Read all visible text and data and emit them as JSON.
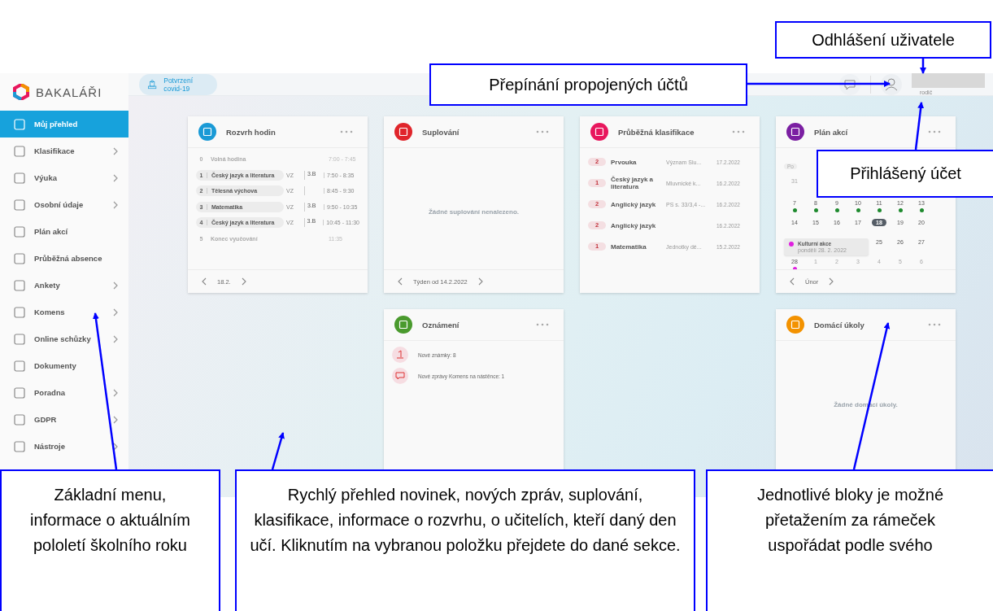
{
  "sidebar": {
    "brand": "BAKALÁŘI",
    "items": [
      {
        "label": "Můj přehled",
        "selected": true,
        "submenu": false
      },
      {
        "label": "Klasifikace",
        "selected": false,
        "submenu": true
      },
      {
        "label": "Výuka",
        "selected": false,
        "submenu": true
      },
      {
        "label": "Osobní údaje",
        "selected": false,
        "submenu": true
      },
      {
        "label": "Plán akcí",
        "selected": false,
        "submenu": false
      },
      {
        "label": "Průběžná absence",
        "selected": false,
        "submenu": false
      },
      {
        "label": "Ankety",
        "selected": false,
        "submenu": true
      },
      {
        "label": "Komens",
        "selected": false,
        "submenu": true
      },
      {
        "label": "Online schůzky",
        "selected": false,
        "submenu": true
      },
      {
        "label": "Dokumenty",
        "selected": false,
        "submenu": false
      },
      {
        "label": "Poradna",
        "selected": false,
        "submenu": true
      },
      {
        "label": "GDPR",
        "selected": false,
        "submenu": true
      },
      {
        "label": "Nástroje",
        "selected": false,
        "submenu": true
      }
    ]
  },
  "topbar": {
    "covid_button": "Potvrzení covid-19",
    "user_role": "rodič"
  },
  "cards": [
    {
      "kind": "schedule",
      "title": "Rozvrh hodin",
      "color": "#1a9ad6",
      "footer": "18.2.",
      "rows": [
        {
          "kind": "free",
          "num": "0",
          "subject": "Volná hodina",
          "time": "7:00 - 7:45"
        },
        {
          "kind": "lesson",
          "num": "1",
          "subject": "Český jazyk a literatura",
          "teacher": "VZ",
          "room": "3.B",
          "time": "7:50 - 8:35"
        },
        {
          "kind": "lesson",
          "num": "2",
          "subject": "Tělesná výchova",
          "teacher": "VZ",
          "time": "8:45 - 9:30"
        },
        {
          "kind": "lesson",
          "num": "3",
          "subject": "Matematika",
          "teacher": "VZ",
          "room": "3.B",
          "time": "9:50 - 10:35"
        },
        {
          "kind": "lesson",
          "num": "4",
          "subject": "Český jazyk a literatura",
          "teacher": "VZ",
          "room": "3.B",
          "time": "10:45 - 11:30"
        },
        {
          "kind": "free",
          "num": "5",
          "subject": "Konec vyučování",
          "time": "11:35"
        }
      ]
    },
    {
      "kind": "empty",
      "title": "Suplování",
      "color": "#e0252b",
      "footer": "Týden od 14.2.2022",
      "message": "Žádné suplování nenalezeno."
    },
    {
      "kind": "grades",
      "title": "Průběžná klasifikace",
      "color": "#e8175d",
      "rows": [
        {
          "grade": "2",
          "subject": "Prvouka",
          "note": "Význam Slu...",
          "date": "17.2.2022"
        },
        {
          "grade": "1",
          "subject": "Český jazyk a literatura",
          "note": "Mluvnické k...",
          "date": "16.2.2022"
        },
        {
          "grade": "2",
          "subject": "Anglický jazyk",
          "note": "PS s. 33/3,4 -...",
          "date": "16.2.2022"
        },
        {
          "grade": "2",
          "subject": "Anglický jazyk",
          "date": "16.2.2022"
        },
        {
          "grade": "1",
          "subject": "Matematika",
          "note": "Jednotky dé...",
          "date": "15.2.2022"
        }
      ]
    },
    {
      "kind": "calendar",
      "title": "Plán akcí",
      "color": "#7b1fa2",
      "footer": "Únor",
      "weekday": "Po",
      "weeks": [
        {
          "kind": "week",
          "days": [
            {
              "text": "31",
              "muted": true,
              "selected": false
            }
          ]
        },
        {
          "kind": "week",
          "days": [
            {
              "text": "7",
              "muted": false,
              "selected": false,
              "color": "#1e8a2e"
            },
            {
              "text": "8",
              "muted": false,
              "selected": false,
              "color": "#1e8a2e"
            },
            {
              "text": "9",
              "muted": false,
              "selected": false,
              "color": "#1e8a2e"
            },
            {
              "text": "10",
              "muted": false,
              "selected": false,
              "color": "#1e8a2e"
            },
            {
              "text": "11",
              "muted": false,
              "selected": false,
              "color": "#1e8a2e"
            },
            {
              "text": "12",
              "muted": false,
              "selected": false,
              "color": "#1e8a2e"
            },
            {
              "text": "13",
              "muted": false,
              "selected": false,
              "color": "#1e8a2e"
            }
          ]
        },
        {
          "kind": "week",
          "days": [
            {
              "text": "14",
              "muted": false,
              "selected": false
            },
            {
              "text": "15",
              "muted": false,
              "selected": false
            },
            {
              "text": "16",
              "muted": false,
              "selected": false
            },
            {
              "text": "17",
              "muted": false,
              "selected": false
            },
            {
              "text": "18",
              "muted": false,
              "selected": true
            },
            {
              "text": "19",
              "muted": false,
              "selected": false
            },
            {
              "text": "20",
              "muted": false,
              "selected": false
            }
          ]
        },
        {
          "kind": "tooltip",
          "tooltip": {
            "title": "Kulturní akce",
            "date": "pondělí 28. 2. 2022",
            "color": "#e020e0"
          },
          "days": [
            {
              "text": "25",
              "muted": false,
              "selected": false
            },
            {
              "text": "26",
              "muted": false,
              "selected": false
            },
            {
              "text": "27",
              "muted": false,
              "selected": false
            }
          ]
        },
        {
          "kind": "week",
          "days": [
            {
              "text": "28",
              "muted": false,
              "selected": false,
              "color": "#e020e0"
            },
            {
              "text": "1",
              "muted": true,
              "selected": false
            },
            {
              "text": "2",
              "muted": true,
              "selected": false
            },
            {
              "text": "3",
              "muted": true,
              "selected": false
            },
            {
              "text": "4",
              "muted": true,
              "selected": false
            },
            {
              "text": "5",
              "muted": true,
              "selected": false
            },
            {
              "text": "6",
              "muted": true,
              "selected": false
            }
          ]
        }
      ]
    },
    {
      "kind": "spacer"
    },
    {
      "kind": "notices",
      "title": "Oznámení",
      "color": "#4a9a2e",
      "rows": [
        {
          "kind": "grade",
          "text": "Nové známky: 8"
        },
        {
          "kind": "message",
          "text": "Nové zprávy Komens na nástěnce: 1"
        }
      ]
    },
    {
      "kind": "spacer"
    },
    {
      "kind": "empty",
      "title": "Domácí úkoly",
      "color": "#f39200",
      "message": "Žádné domácí úkoly."
    }
  ],
  "callouts": [
    {
      "kind": "logout",
      "text": "Odhlášení uživatele"
    },
    {
      "kind": "switch",
      "text": "Přepínání propojených účtů"
    },
    {
      "kind": "account",
      "text": "Přihlášený účet"
    },
    {
      "kind": "menu",
      "text": "Základní menu, informace o aktuálním pololetí školního roku"
    },
    {
      "kind": "overview",
      "text": "Rychlý přehled novinek, nových zpráv, suplování, klasifikace, informace o rozvrhu, o učitelích, kteří daný den učí. Kliknutím na vybranou položku přejdete do dané sekce."
    },
    {
      "kind": "blocks",
      "text": "Jednotlivé bloky je možné přetažením za rámeček uspořádat podle svého"
    }
  ]
}
